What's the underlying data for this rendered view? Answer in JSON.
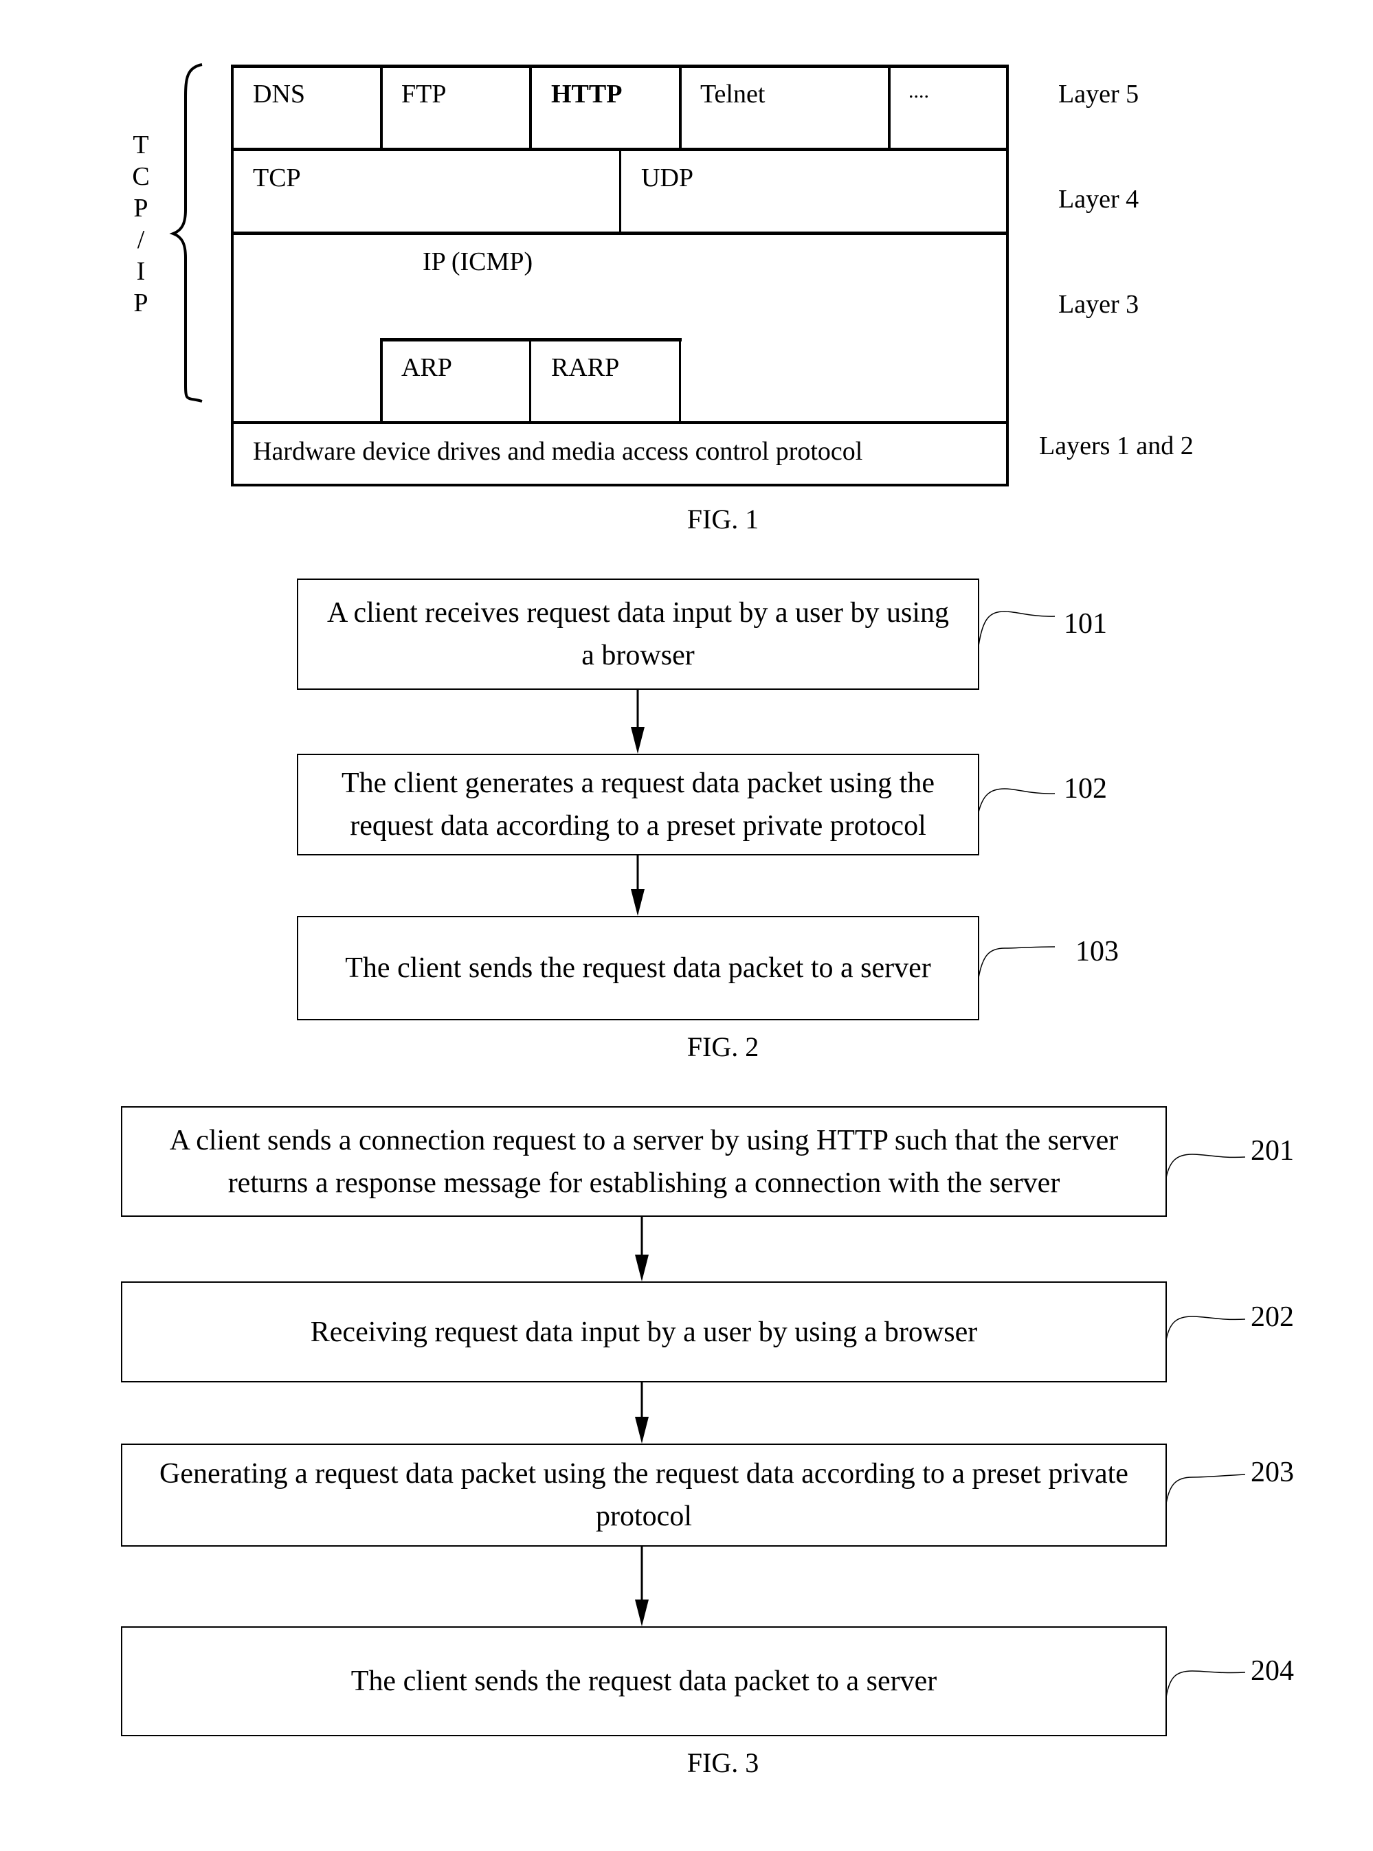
{
  "fig1": {
    "caption": "FIG. 1",
    "stack_label_letters": [
      "T",
      "C",
      "P",
      "/",
      "I",
      "P"
    ],
    "layer5": {
      "cells": [
        "DNS",
        "FTP",
        "HTTP",
        "Telnet",
        "...."
      ],
      "label": "Layer 5"
    },
    "layer4": {
      "cells": [
        "TCP",
        "UDP"
      ],
      "label": "Layer 4"
    },
    "layer3": {
      "main": "IP (ICMP)",
      "cells": [
        "ARP",
        "RARP"
      ],
      "label": "Layer 3"
    },
    "layer12": {
      "text": "Hardware device drives and media access control protocol",
      "label": "Layers 1 and 2"
    }
  },
  "fig2": {
    "caption": "FIG. 2",
    "steps": [
      {
        "ref": "101",
        "text": "A client receives request data input by a user by using a browser"
      },
      {
        "ref": "102",
        "text": "The client generates a request data packet using the request data according to a preset private protocol"
      },
      {
        "ref": "103",
        "text": "The client sends the request data packet to a server"
      }
    ]
  },
  "fig3": {
    "caption": "FIG. 3",
    "steps": [
      {
        "ref": "201",
        "text": "A client sends a connection request to a server by using HTTP such that the server returns a response message for establishing a connection with the server"
      },
      {
        "ref": "202",
        "text": "Receiving request data input by a user by using a browser"
      },
      {
        "ref": "203",
        "text": "Generating a request data packet using the request data according to a preset private protocol"
      },
      {
        "ref": "204",
        "text": "The client sends the request data packet to a server"
      }
    ]
  }
}
